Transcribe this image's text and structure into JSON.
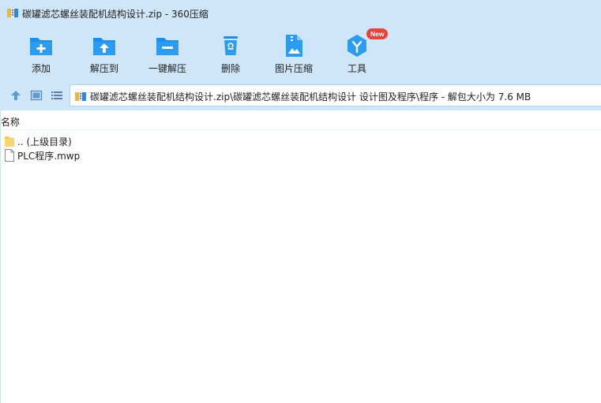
{
  "window": {
    "title": "碳罐滤芯螺丝装配机结构设计.zip - 360压缩"
  },
  "toolbar": {
    "items": [
      {
        "label": "添加",
        "icon": "add-folder-icon"
      },
      {
        "label": "解压到",
        "icon": "extract-to-icon"
      },
      {
        "label": "一键解压",
        "icon": "one-click-extract-icon"
      },
      {
        "label": "删除",
        "icon": "trash-icon"
      },
      {
        "label": "图片压缩",
        "icon": "image-compress-icon"
      },
      {
        "label": "工具",
        "icon": "tools-icon",
        "badge": "New"
      }
    ]
  },
  "address": {
    "path": "碳罐滤芯螺丝装配机结构设计.zip\\碳罐滤芯螺丝装配机结构设计  设计图及程序\\程序 - 解包大小为 7.6 MB"
  },
  "list": {
    "column_name": "名称",
    "rows": [
      {
        "name": ".. (上级目录)",
        "type": "folder"
      },
      {
        "name": "PLC程序.mwp",
        "type": "file"
      }
    ]
  },
  "colors": {
    "chrome_bg": "#cfe6f8",
    "icon_blue": "#1e8fe6",
    "badge_red": "#e8423b",
    "folder_yellow": "#f6c94c"
  }
}
